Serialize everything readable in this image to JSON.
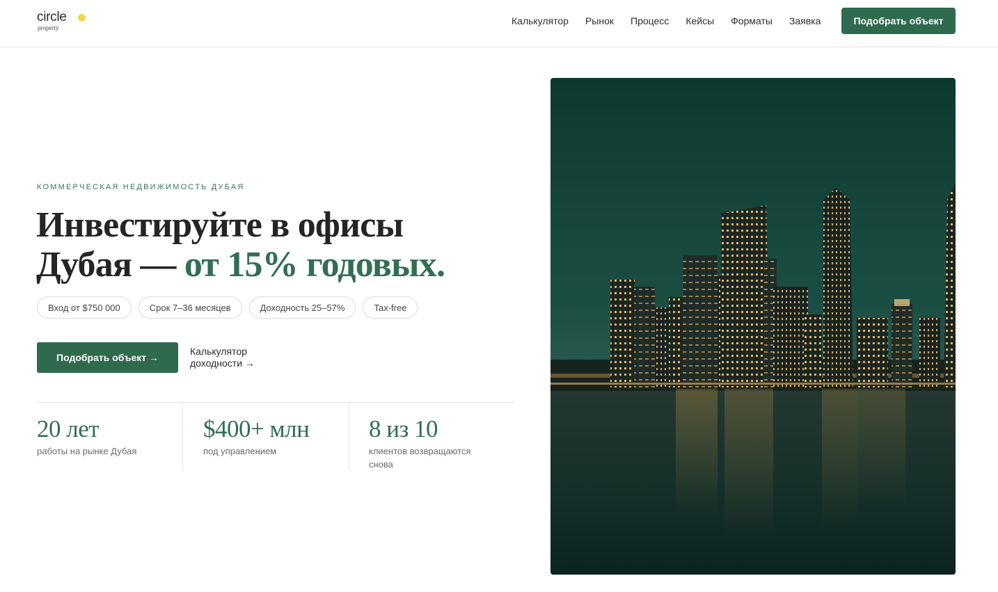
{
  "header": {
    "logo": {
      "word": "circle",
      "sub": "property"
    },
    "nav": [
      {
        "label": "Калькулятор"
      },
      {
        "label": "Рынок"
      },
      {
        "label": "Процесс"
      },
      {
        "label": "Кейсы"
      },
      {
        "label": "Форматы"
      },
      {
        "label": "Заявка"
      }
    ],
    "cta_label": "Подобрать объект"
  },
  "hero": {
    "eyebrow": "Коммерческая недвижимость Дубая",
    "headline_part1": "Инвестируйте в офисы",
    "headline_part2": "Дубая — ",
    "headline_accent": "от 15% годовых.",
    "chips": [
      "Вход от $750 000",
      "Срок 7–36 месяцев",
      "Доходность 25–57%",
      "Tax-free"
    ],
    "primary_cta": "Подобрать объект →",
    "secondary_link": "Калькулятор доходности →",
    "stats": [
      {
        "value": "20 лет",
        "label": "работы на рынке Дубая"
      },
      {
        "value": "$400+ млн",
        "label": "под управлением"
      },
      {
        "value": "8 из 10",
        "label": "клиентов возвращаются снова"
      }
    ]
  },
  "colors": {
    "brand_green": "#2f6a4f",
    "accent_green": "#326e52",
    "logo_dot": "#f4d44a"
  }
}
